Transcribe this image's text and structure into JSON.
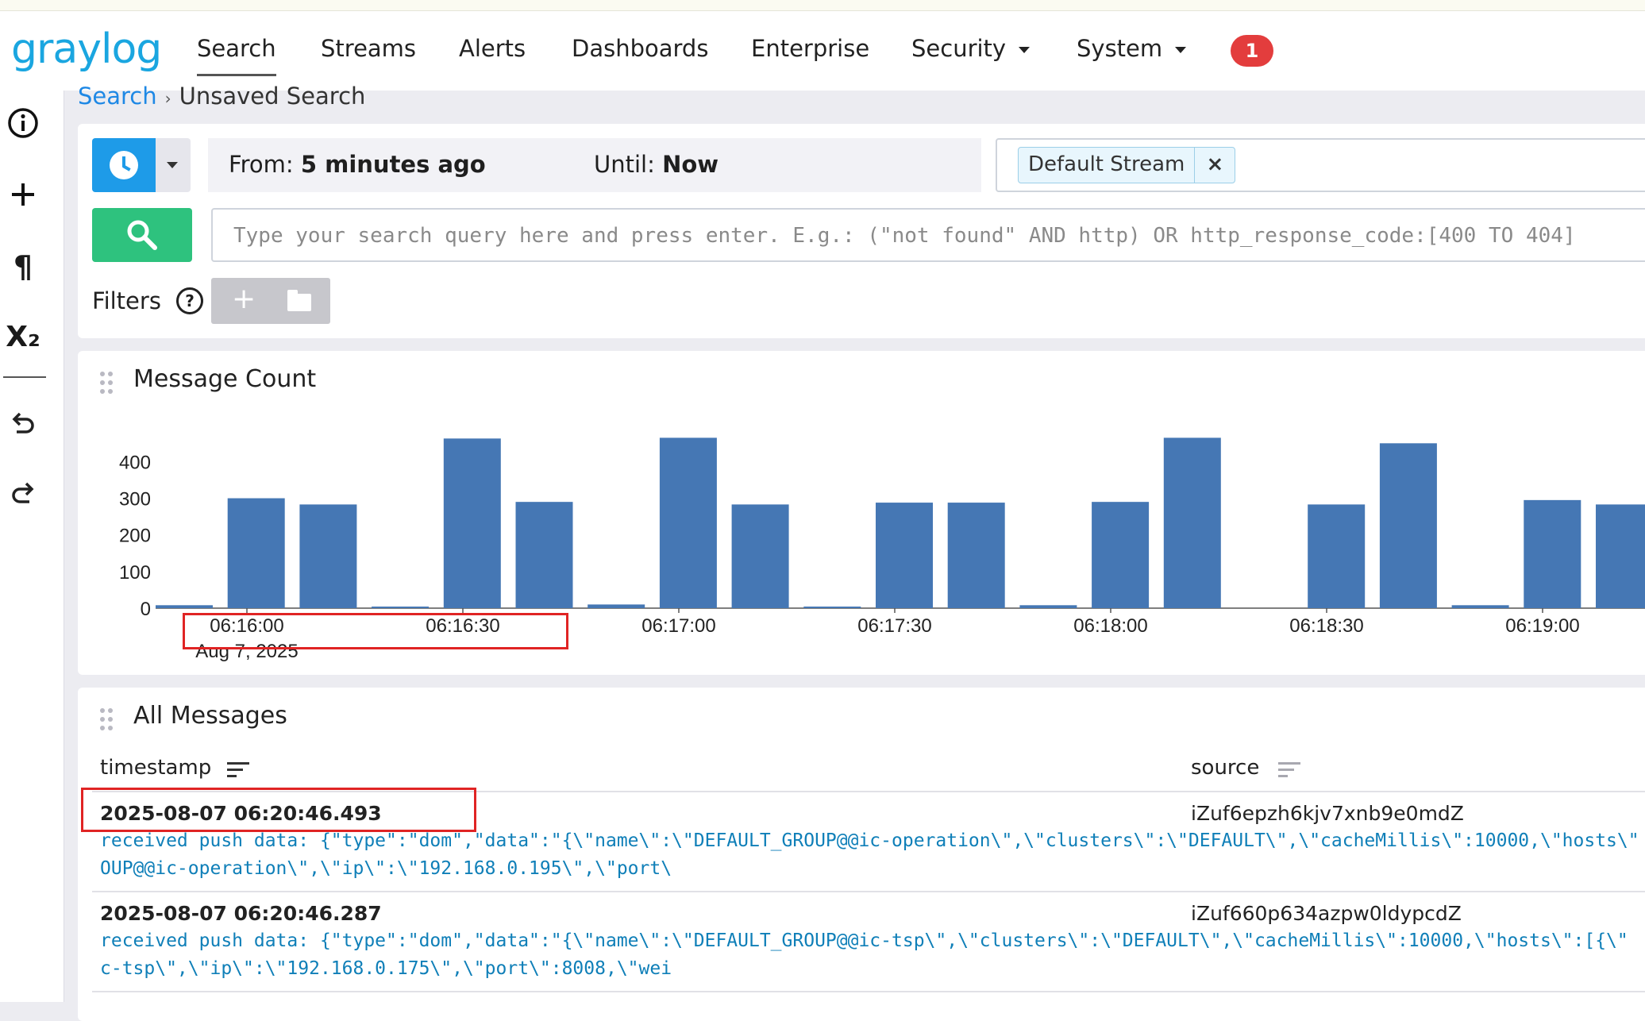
{
  "app": {
    "logo_text": "graylog"
  },
  "nav": {
    "items": [
      {
        "label": "Search",
        "active": true
      },
      {
        "label": "Streams"
      },
      {
        "label": "Alerts"
      },
      {
        "label": "Dashboards"
      },
      {
        "label": "Enterprise"
      },
      {
        "label": "Security",
        "dropdown": true
      },
      {
        "label": "System",
        "dropdown": true
      }
    ],
    "notification_count": "1"
  },
  "sidebar": {
    "icons": [
      "info-icon",
      "plus-icon",
      "pilcrow-icon",
      "subscript-icon",
      "undo-icon",
      "redo-icon"
    ],
    "subscript_glyph": "X₂"
  },
  "breadcrumb": {
    "root": "Search",
    "current": "Unsaved Search"
  },
  "search": {
    "from_label": "From:",
    "from_value": "5 minutes ago",
    "until_label": "Until:",
    "until_value": "Now",
    "stream_chip": "Default Stream",
    "stream_remove": "×",
    "query_placeholder": "Type your search query here and press enter. E.g.: (\"not found\" AND http) OR http_response_code:[400 TO 404]",
    "filters_label": "Filters",
    "filters_help": "?",
    "filter_add": "+"
  },
  "message_count": {
    "title": "Message Count"
  },
  "chart_data": {
    "type": "bar",
    "title": "Message Count",
    "x_tick_labels": [
      "06:16:00",
      "06:16:30",
      "06:17:00",
      "06:17:30",
      "06:18:00",
      "06:18:30",
      "06:19:00"
    ],
    "x_date_label": "Aug 7, 2025",
    "y_ticks": [
      0,
      100,
      200,
      300,
      400
    ],
    "ylim": [
      0,
      470
    ],
    "grid": false,
    "bar_color": "#4577b4",
    "values": [
      8,
      300,
      283,
      4,
      463,
      290,
      10,
      465,
      283,
      3,
      288,
      288,
      8,
      290,
      465,
      0,
      283,
      450,
      8,
      295,
      283
    ]
  },
  "all_messages": {
    "title": "All Messages",
    "columns": [
      "timestamp",
      "source"
    ],
    "rows": [
      {
        "timestamp": "2025-08-07 06:20:46.493",
        "source": "iZuf6epzh6kjv7xnb9e0mdZ",
        "line1": "received push data: {\"type\":\"dom\",\"data\":\"{\\\"name\\\":\\\"DEFAULT_GROUP@@ic-operation\\\",\\\"clusters\\\":\\\"DEFAULT\\\",\\\"cacheMillis\\\":10000,\\\"hosts\\\"",
        "line2": "OUP@@ic-operation\\\",\\\"ip\\\":\\\"192.168.0.195\\\",\\\"port\\"
      },
      {
        "timestamp": "2025-08-07 06:20:46.287",
        "source": "iZuf660p634azpw0ldypcdZ",
        "line1": "received push data: {\"type\":\"dom\",\"data\":\"{\\\"name\\\":\\\"DEFAULT_GROUP@@ic-tsp\\\",\\\"clusters\\\":\\\"DEFAULT\\\",\\\"cacheMillis\\\":10000,\\\"hosts\\\":[{\\\"",
        "line2": "c-tsp\\\",\\\"ip\\\":\\\"192.168.0.175\\\",\\\"port\\\":8008,\\\"wei"
      }
    ]
  }
}
